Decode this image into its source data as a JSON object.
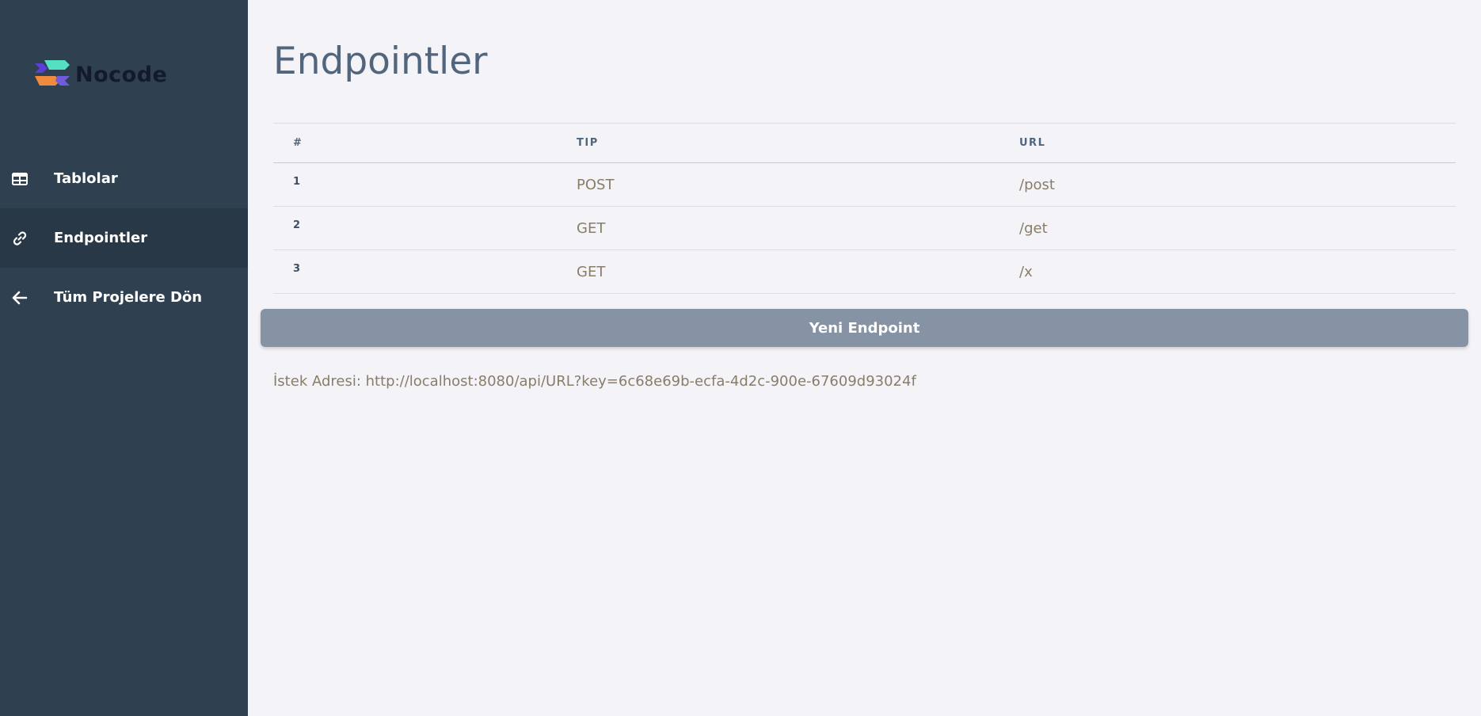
{
  "sidebar": {
    "logo_text": "Nocode",
    "items": [
      {
        "label": "Tablolar",
        "icon": "table-icon"
      },
      {
        "label": "Endpointler",
        "icon": "link-icon",
        "active": true
      },
      {
        "label": "Tüm Projelere Dön",
        "icon": "arrow-left-icon"
      }
    ]
  },
  "main": {
    "title": "Endpointler",
    "table": {
      "headers": [
        "#",
        "TIP",
        "URL"
      ],
      "rows": [
        {
          "num": "1",
          "tip": "POST",
          "url": "/post"
        },
        {
          "num": "2",
          "tip": "GET",
          "url": "/get"
        },
        {
          "num": "3",
          "tip": "GET",
          "url": "/x"
        }
      ]
    },
    "new_button": "Yeni Endpoint",
    "request_address": "İstek Adresi: http://localhost:8080/api/URL?key=6c68e69b-ecfa-4d2c-900e-67609d93024f"
  },
  "colors": {
    "sidebar_bg": "#2f4050",
    "sidebar_active_bg": "#293846",
    "page_bg": "#f4f3f8",
    "title": "#51657d",
    "cell_text": "#887d69",
    "button_bg": "#8593a5"
  }
}
